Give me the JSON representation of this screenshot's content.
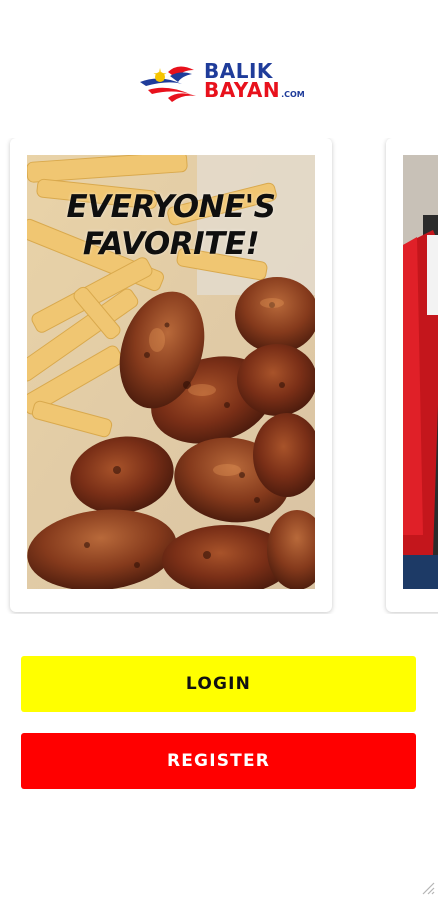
{
  "logo": {
    "line1": "BALIK",
    "line2": "BAYAN",
    "suffix": ".COM",
    "colors": {
      "primary": "#1f3c9a",
      "secondary": "#e8111c",
      "accent": "#f5c400"
    }
  },
  "carousel": {
    "slides": [
      {
        "headline_line1": "EVERYONE'S",
        "headline_line2": "FAVORITE!",
        "image": "chicken-wings-and-fries"
      },
      {
        "image": "person-in-red-jacket"
      }
    ]
  },
  "actions": {
    "login_label": "LOGIN",
    "register_label": "REGISTER",
    "login_color": "#ffff00",
    "register_color": "#ff0000"
  },
  "icons": {
    "resize": "resize-handle-icon"
  }
}
